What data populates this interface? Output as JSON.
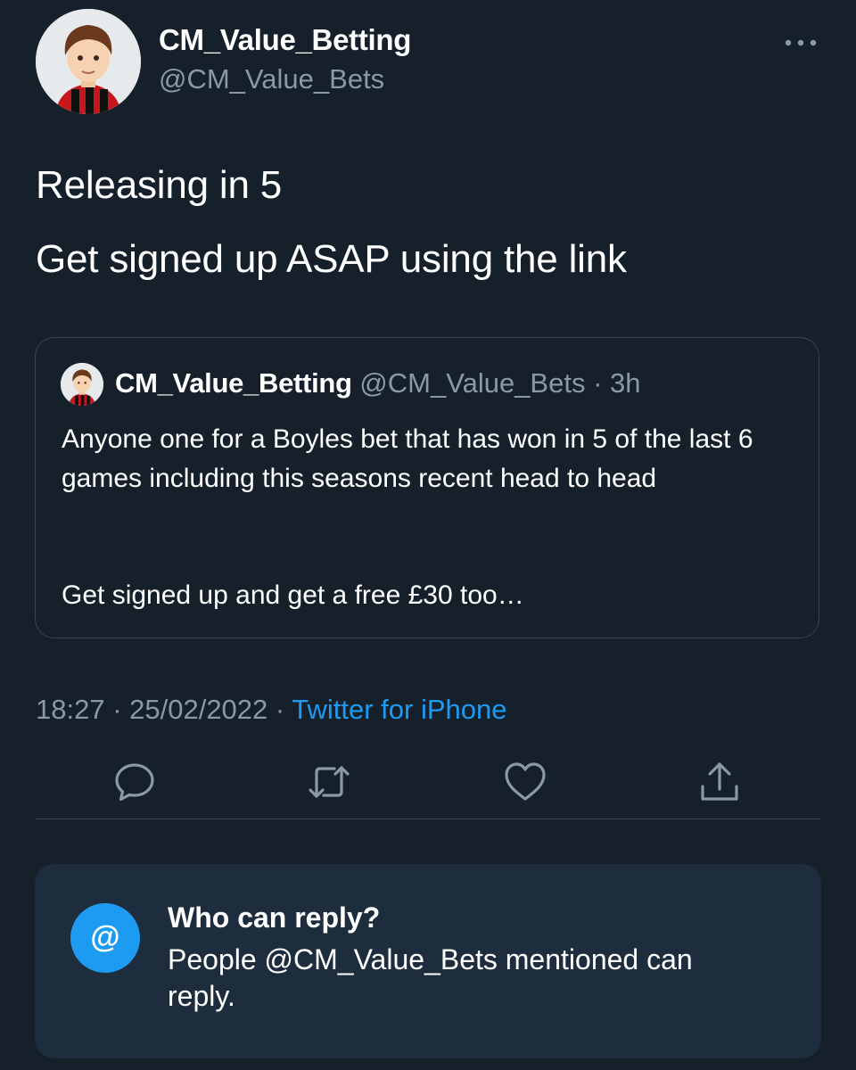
{
  "author": {
    "display_name": "CM_Value_Betting",
    "handle": "@CM_Value_Bets"
  },
  "tweet": {
    "lines": [
      "Releasing in 5",
      "Get signed up ASAP using the link"
    ]
  },
  "quoted_tweet": {
    "display_name": "CM_Value_Betting",
    "meta": "@CM_Value_Bets · 3h",
    "body": [
      "Anyone one for a Boyles bet that has won in 5 of the last 6 games including this seasons recent head to head",
      "Get signed up and get a free £30 too…"
    ]
  },
  "timestamp": {
    "time_date": "18:27 · 25/02/2022 · ",
    "source": "Twitter for iPhone"
  },
  "actions": {
    "icons": [
      "reply-icon",
      "retweet-icon",
      "like-icon",
      "share-icon"
    ]
  },
  "reply_settings": {
    "badge": "@",
    "title": "Who can reply?",
    "description": "People @CM_Value_Bets mentioned can reply."
  },
  "colors": {
    "background": "#15202b",
    "card": "#1e2d3e",
    "accent": "#1d9bf0",
    "muted_text": "#8b98a5",
    "border": "#38444d"
  }
}
